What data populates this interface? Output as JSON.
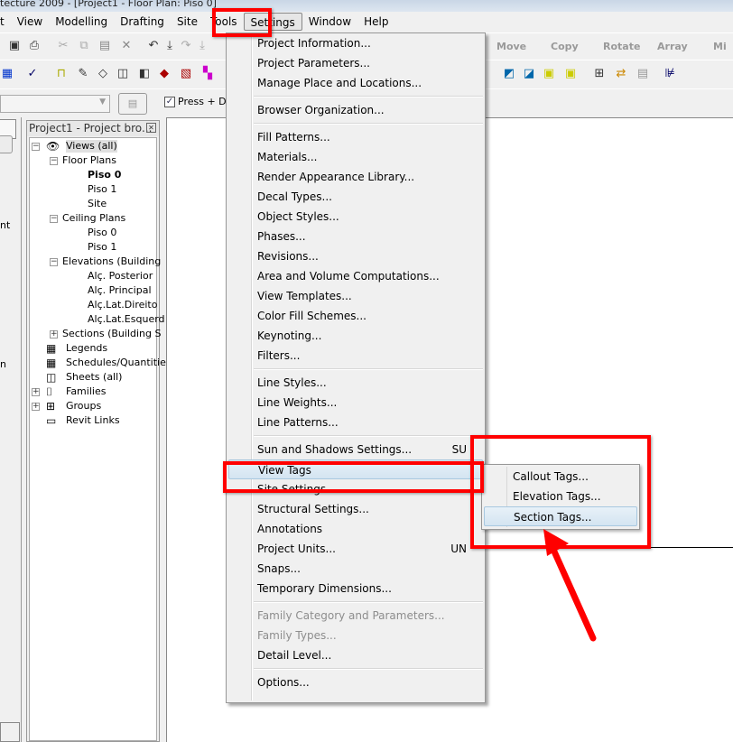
{
  "window": {
    "title": "tecture 2009 - [Project1 - Floor Plan: Piso 0]"
  },
  "menubar": [
    "t",
    "View",
    "Modelling",
    "Drafting",
    "Site",
    "Tools",
    "Settings",
    "Window",
    "Help"
  ],
  "toolbar": {
    "press_drag_label": "Press + Dra",
    "press_drag_checked": true,
    "edit_tools": [
      "Move",
      "Copy",
      "Rotate",
      "Array",
      "Mi"
    ]
  },
  "left_panel": {
    "fragments": [
      "nt",
      "n"
    ]
  },
  "project_browser": {
    "title": "Project1 - Project bro...",
    "tree": [
      {
        "label": "Views (all)",
        "level": 0,
        "expander": "minus",
        "icon": "eye"
      },
      {
        "label": "Floor Plans",
        "level": 1,
        "expander": "minus"
      },
      {
        "label": "Piso 0",
        "level": 2,
        "bold": true
      },
      {
        "label": "Piso 1",
        "level": 2
      },
      {
        "label": "Site",
        "level": 2
      },
      {
        "label": "Ceiling Plans",
        "level": 1,
        "expander": "minus"
      },
      {
        "label": "Piso 0",
        "level": 2
      },
      {
        "label": "Piso 1",
        "level": 2
      },
      {
        "label": "Elevations (Building",
        "level": 1,
        "expander": "minus"
      },
      {
        "label": "Alç. Posterior",
        "level": 2
      },
      {
        "label": "Alç. Principal",
        "level": 2
      },
      {
        "label": "Alç.Lat.Direito",
        "level": 2
      },
      {
        "label": "Alç.Lat.Esquerd",
        "level": 2
      },
      {
        "label": "Sections (Building S",
        "level": 1,
        "expander": "plus"
      },
      {
        "label": "Legends",
        "level": 0,
        "icon": "legend"
      },
      {
        "label": "Schedules/Quantitie",
        "level": 0,
        "icon": "schedule"
      },
      {
        "label": "Sheets (all)",
        "level": 0,
        "icon": "sheet"
      },
      {
        "label": "Families",
        "level": 0,
        "expander": "plus",
        "icon": "family"
      },
      {
        "label": "Groups",
        "level": 0,
        "expander": "plus",
        "icon": "group"
      },
      {
        "label": "Revit Links",
        "level": 0,
        "icon": "link"
      }
    ]
  },
  "settings_menu": {
    "items": [
      {
        "label": "Project Information..."
      },
      {
        "label": "Project Parameters..."
      },
      {
        "label": "Manage Place and Locations..."
      },
      {
        "sep": true
      },
      {
        "label": "Browser Organization..."
      },
      {
        "sep": true
      },
      {
        "label": "Fill Patterns..."
      },
      {
        "label": "Materials..."
      },
      {
        "label": "Render Appearance Library..."
      },
      {
        "label": "Decal Types..."
      },
      {
        "label": "Object Styles..."
      },
      {
        "label": "Phases..."
      },
      {
        "label": "Revisions..."
      },
      {
        "label": "Area and Volume Computations..."
      },
      {
        "label": "View Templates..."
      },
      {
        "label": "Color Fill Schemes..."
      },
      {
        "label": "Keynoting..."
      },
      {
        "label": "Filters..."
      },
      {
        "sep": true
      },
      {
        "label": "Line Styles..."
      },
      {
        "label": "Line Weights..."
      },
      {
        "label": "Line Patterns..."
      },
      {
        "sep": true
      },
      {
        "label": "Sun and Shadows Settings...",
        "shortcut": "SU"
      },
      {
        "label": "View Tags",
        "highlighted": true,
        "submenu": true
      },
      {
        "label": "Site Settings..."
      },
      {
        "label": "Structural Settings..."
      },
      {
        "label": "Annotations"
      },
      {
        "label": "Project Units...",
        "shortcut": "UN"
      },
      {
        "label": "Snaps..."
      },
      {
        "label": "Temporary Dimensions..."
      },
      {
        "sep": true
      },
      {
        "label": "Family Category and Parameters...",
        "disabled": true
      },
      {
        "label": "Family Types...",
        "disabled": true
      },
      {
        "label": "Detail Level..."
      },
      {
        "sep": true
      },
      {
        "label": "Options..."
      }
    ]
  },
  "view_tags_submenu": {
    "items": [
      {
        "label": "Callout Tags..."
      },
      {
        "label": "Elevation Tags..."
      },
      {
        "label": "Section Tags...",
        "highlighted": true
      }
    ]
  },
  "annotation": {
    "color": "#ff0000"
  }
}
